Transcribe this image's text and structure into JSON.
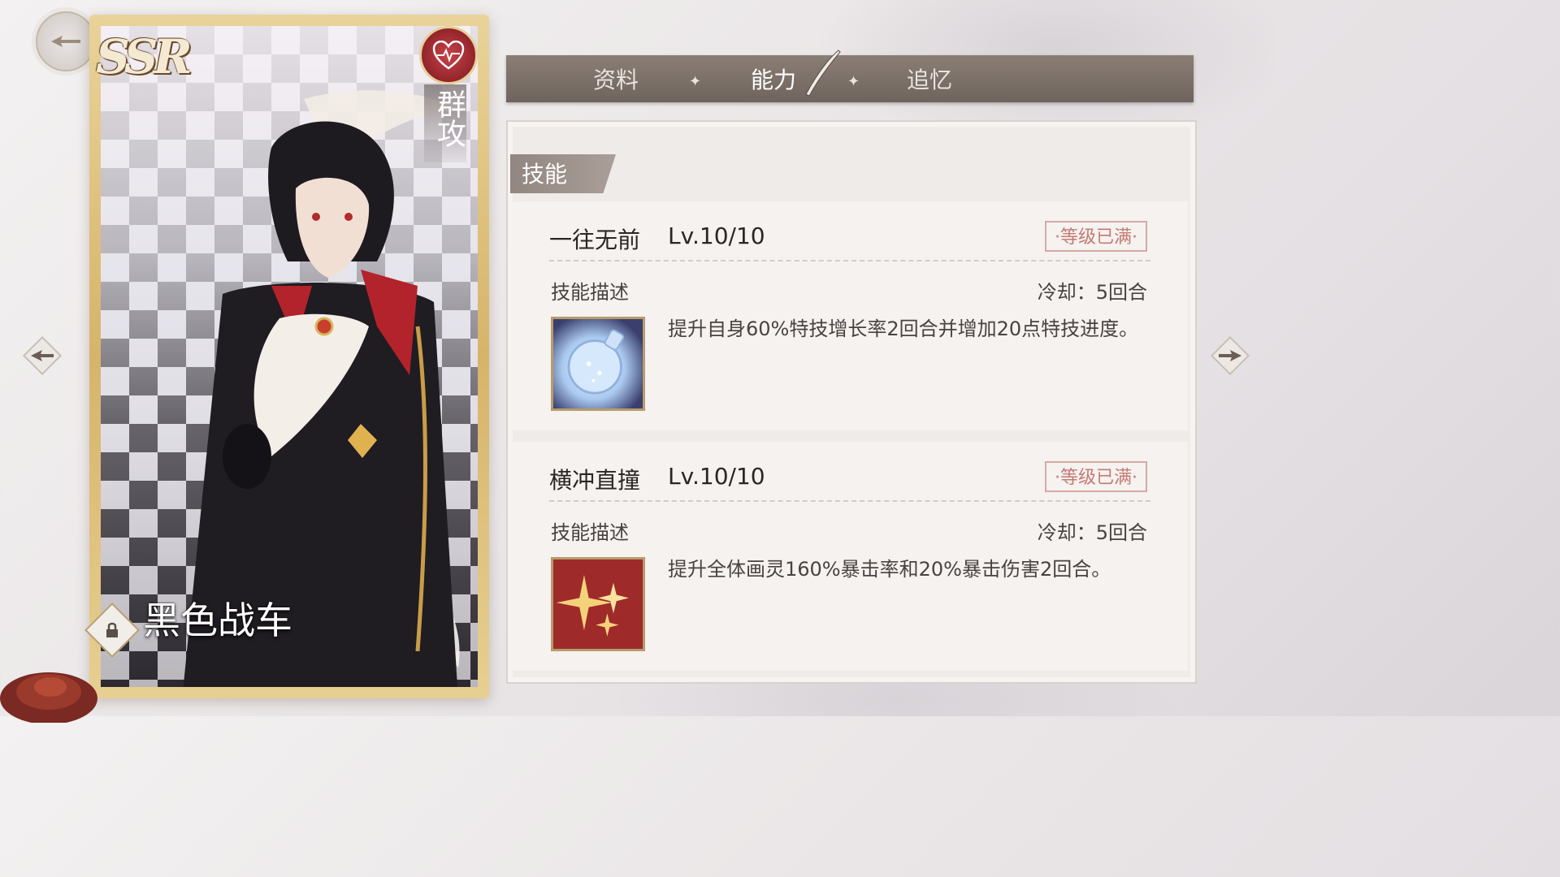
{
  "card": {
    "rarity": "SSR",
    "attack_type": "群攻",
    "character_name": "黑色战车"
  },
  "tabs": [
    {
      "label": "资料",
      "active": false
    },
    {
      "label": "能力",
      "active": true
    },
    {
      "label": "追忆",
      "active": false
    }
  ],
  "tab_separator": "✦",
  "section": {
    "label": "技能"
  },
  "skills": [
    {
      "name": "一往无前",
      "level": "Lv.10/10",
      "status": "·等级已满·",
      "desc_title": "技能描述",
      "cooldown": "冷却：5回合",
      "description": "提升自身60%特技增长率2回合并增加20点特技进度。",
      "icon": "potion-icon"
    },
    {
      "name": "横冲直撞",
      "level": "Lv.10/10",
      "status": "·等级已满·",
      "desc_title": "技能描述",
      "cooldown": "冷却：5回合",
      "description": "提升全体画灵160%暴击率和20%暴击伤害2回合。",
      "icon": "sparkle-icon"
    }
  ],
  "colors": {
    "tab_bar": "#7a6f67",
    "maxed_badge": "#c47a73",
    "card_frame": "#d6b46a",
    "heart_badge": "#b8333b"
  }
}
